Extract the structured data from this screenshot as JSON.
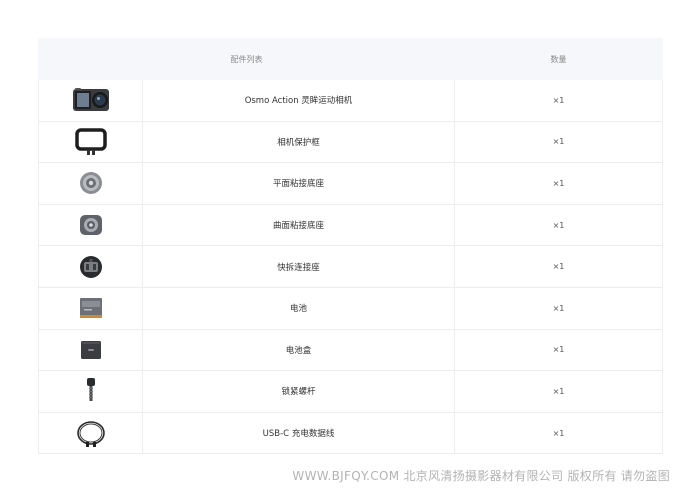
{
  "table": {
    "headers": {
      "name": "配件列表",
      "qty": "数量"
    },
    "rows": [
      {
        "name": "Osmo Action 灵眸运动相机",
        "qty": "×1",
        "icon": "camera-icon"
      },
      {
        "name": "相机保护框",
        "qty": "×1",
        "icon": "protective-frame-icon"
      },
      {
        "name": "平面粘接底座",
        "qty": "×1",
        "icon": "flat-adhesive-mount-icon"
      },
      {
        "name": "曲面粘接底座",
        "qty": "×1",
        "icon": "curved-adhesive-mount-icon"
      },
      {
        "name": "快拆连接座",
        "qty": "×1",
        "icon": "quick-release-base-icon"
      },
      {
        "name": "电池",
        "qty": "×1",
        "icon": "battery-icon"
      },
      {
        "name": "电池盒",
        "qty": "×1",
        "icon": "battery-case-icon"
      },
      {
        "name": "锁紧螺杆",
        "qty": "×1",
        "icon": "locking-screw-icon"
      },
      {
        "name": "USB-C 充电数据线",
        "qty": "×1",
        "icon": "usb-c-cable-icon"
      }
    ]
  },
  "watermark": "WWW.BJFQY.COM 北京风清扬摄影器材有限公司 版权所有 请勿盗图"
}
